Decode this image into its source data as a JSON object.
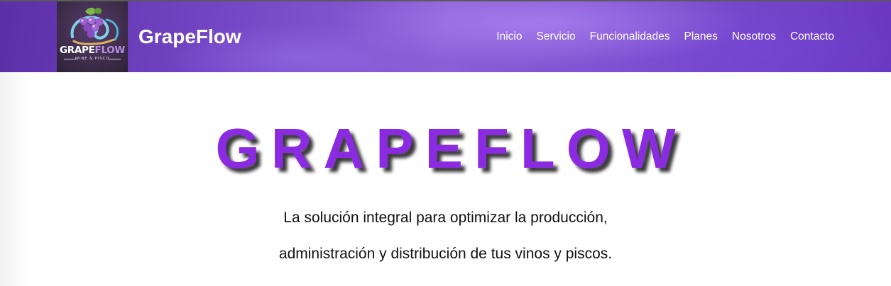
{
  "navbar": {
    "brand": "GrapeFlow",
    "logo": {
      "word_part1": "GRAPE",
      "word_part2": "FLOW",
      "subtitle": "WINE & PISCO",
      "icon": "grape-cluster-wave-logo"
    },
    "links": [
      {
        "label": "Inicio"
      },
      {
        "label": "Servicio"
      },
      {
        "label": "Funcionalidades"
      },
      {
        "label": "Planes"
      },
      {
        "label": "Nosotros"
      },
      {
        "label": "Contacto"
      }
    ]
  },
  "hero": {
    "title": "GRAPEFLOW",
    "line1": "La solución integral para optimizar la producción,",
    "line2": "administración y distribución de tus vinos y piscos."
  },
  "colors": {
    "navbar_purple": "#7446c6",
    "title_purple": "#8a2be2",
    "text_dark": "#111111",
    "white": "#ffffff"
  }
}
